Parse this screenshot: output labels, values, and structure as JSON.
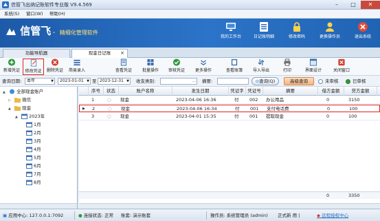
{
  "window": {
    "title": "信管飞出纳记账软件专业版 V9.4.569"
  },
  "menu": [
    "系统(S)",
    "窗口(W)",
    "帮助(H)"
  ],
  "brand": {
    "logo_text": "信管飞",
    "slogan": "精细化管理软件"
  },
  "banner_buttons": [
    {
      "label": "我的工作台",
      "icon": "monitor-icon"
    },
    {
      "label": "日记账明细",
      "icon": "ledger-icon"
    },
    {
      "label": "修改密码",
      "icon": "lock-icon"
    },
    {
      "label": "更换操作员",
      "icon": "user-icon"
    },
    {
      "label": "退出系统",
      "icon": "exit-icon"
    }
  ],
  "tabs": [
    {
      "label": "功能导航器",
      "active": false
    },
    {
      "label": "现金日记账",
      "active": true,
      "close": "×"
    }
  ],
  "toolbar": [
    {
      "label": "新增凭证",
      "icon": "plus-icon",
      "color": "#2e9a3d"
    },
    {
      "label": "修改凭证",
      "icon": "edit-icon",
      "color": "#5a7da8",
      "highlight": true
    },
    {
      "label": "删除凭证",
      "icon": "delete-icon",
      "color": "#d43a2a"
    },
    {
      "label": "简易录入",
      "icon": "list-icon",
      "color": "#3d6fb0"
    },
    {
      "label": "查看凭证",
      "icon": "document-icon",
      "color": "#3d6fb0"
    },
    {
      "label": "批量操作",
      "icon": "grid-icon",
      "color": "#3d6fb0"
    },
    {
      "label": "审核凭证",
      "icon": "check-icon",
      "color": "#2e9a3d"
    },
    {
      "label": "更多操作",
      "icon": "more-icon",
      "color": "#3d6fb0"
    },
    {
      "label": "查看账簿",
      "icon": "book-icon",
      "color": "#3d6fb0"
    },
    {
      "label": "导入导出",
      "icon": "import-export-icon",
      "color": "#3d6fb0"
    },
    {
      "label": "打印",
      "icon": "print-icon",
      "color": "#555555"
    },
    {
      "label": "界面设计",
      "icon": "design-icon",
      "color": "#3d6fb0"
    },
    {
      "label": "关闭窗口",
      "icon": "close-window-icon",
      "color": "#d43a2a"
    }
  ],
  "filter": {
    "date_label": "查询日期:",
    "period": "本年",
    "date_from": "2023-01-01",
    "to": "至",
    "date_to": "2023-12-31",
    "type_label": "收支类别:",
    "type_value": "",
    "summary_label": "摘要:",
    "summary_value": "",
    "query_button": "查询(Q)",
    "advanced_button": "高级查询",
    "unreviewed": "未审核",
    "reviewed": "已审核"
  },
  "tree": [
    {
      "label": "全部现金账户",
      "level": 0,
      "expand": "▲",
      "icon": "folder-icon"
    },
    {
      "label": "微信",
      "level": 1,
      "expand": "▷",
      "icon": "folder-icon"
    },
    {
      "label": "现金",
      "level": 1,
      "expand": "▲",
      "icon": "folder-icon"
    },
    {
      "label": "2023年",
      "level": 2,
      "expand": "▲",
      "icon": "calendar-icon"
    },
    {
      "label": "1月",
      "level": 3,
      "icon": "calendar-icon"
    },
    {
      "label": "2月",
      "level": 3,
      "icon": "calendar-icon"
    },
    {
      "label": "3月",
      "level": 3,
      "icon": "calendar-icon"
    },
    {
      "label": "4月",
      "level": 3,
      "icon": "calendar-icon"
    },
    {
      "label": "5月",
      "level": 3,
      "icon": "calendar-icon"
    },
    {
      "label": "6月",
      "level": 3,
      "icon": "calendar-icon"
    },
    {
      "label": "7月",
      "level": 3,
      "icon": "calendar-icon"
    },
    {
      "label": "8月",
      "level": 3,
      "icon": "calendar-icon"
    }
  ],
  "grid": {
    "columns": [
      "序号",
      "状态",
      "账户名称",
      "发生日期",
      "凭证字",
      "凭证号",
      "摘要",
      "借方金额",
      "贷方金额"
    ],
    "rows": [
      {
        "no": "1",
        "account": "现金",
        "date": "2023-04-06 16:36",
        "word": "付",
        "num": "002",
        "summary": "办公用品",
        "debit": "0",
        "credit": "3150"
      },
      {
        "no": "2",
        "account": "现金",
        "date": "2023-04-06 16:34",
        "word": "付",
        "num": "001",
        "summary": "支付电话费",
        "debit": "0",
        "credit": "100",
        "selected": true
      },
      {
        "no": "3",
        "account": "现金",
        "date": "2023-04-01 15:35",
        "word": "付",
        "num": "001",
        "summary": "提取现金",
        "debit": "0",
        "credit": "100"
      }
    ],
    "total": {
      "debit": "0",
      "credit": "3350"
    }
  },
  "status": {
    "center": "应用中心: 127.0.0.1:7092",
    "connection": "连接状态: 正常",
    "book": "账套: 演示账套",
    "operator": "操作员: 系统管理员 (admin)",
    "version": "正式新 用 |",
    "login": "远程授权中心"
  }
}
